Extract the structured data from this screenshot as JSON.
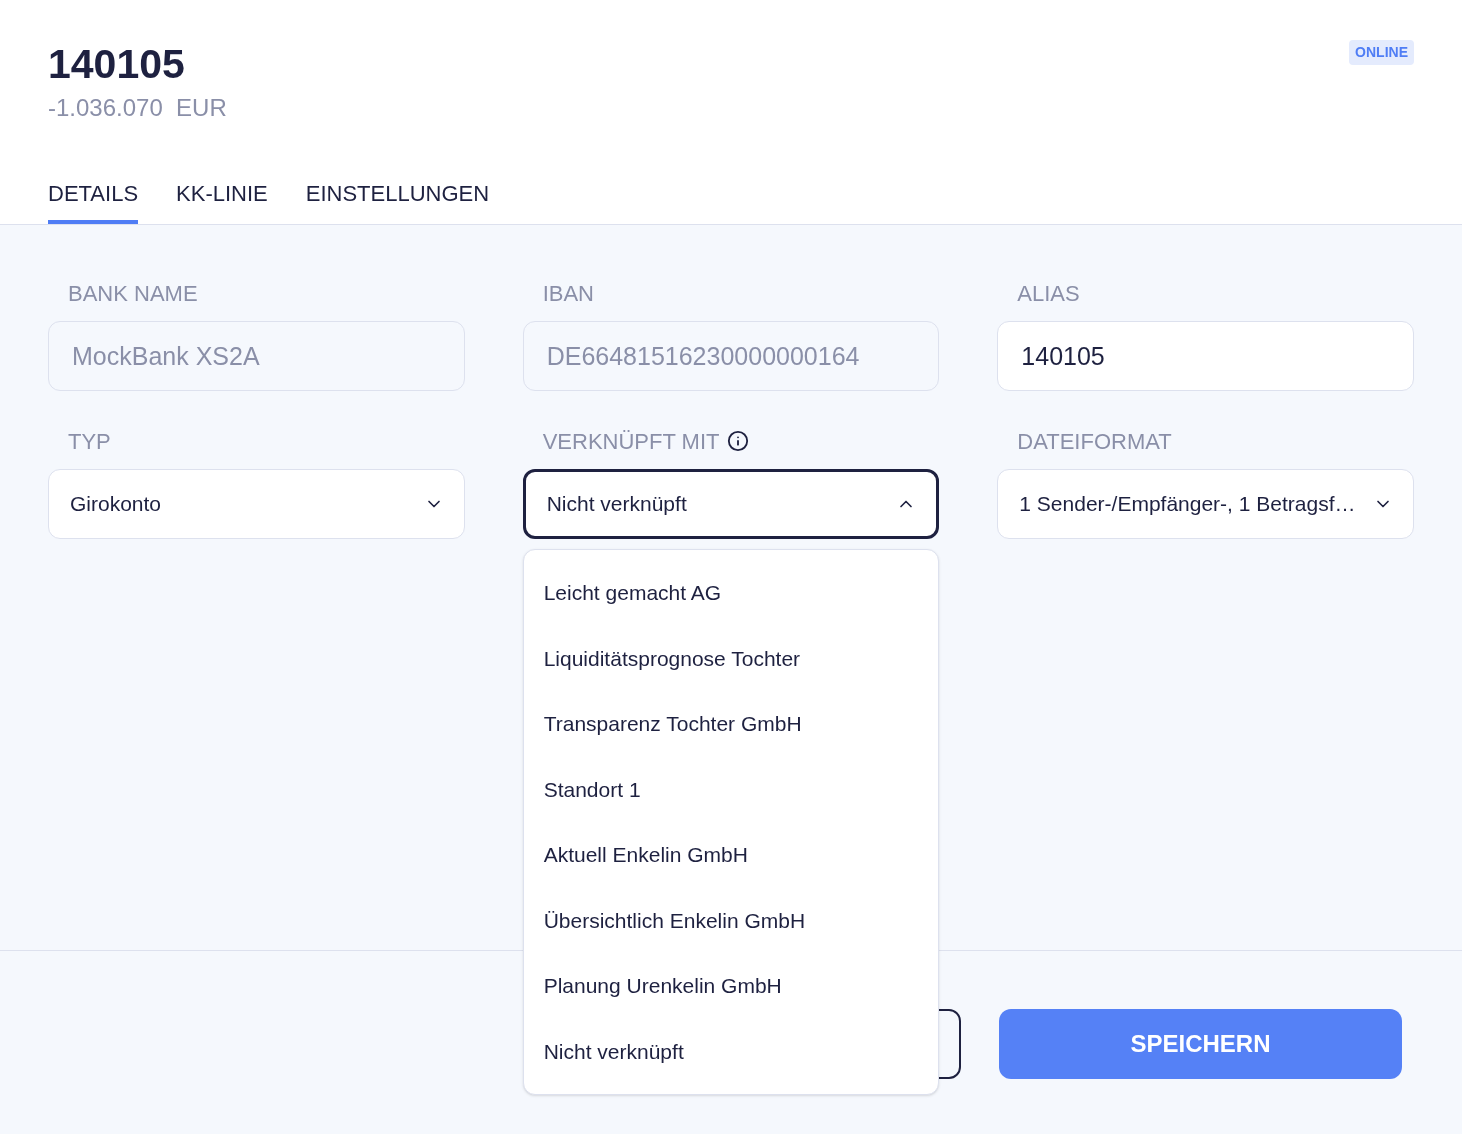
{
  "header": {
    "title": "140105",
    "balance": "-1.036.070  EUR",
    "status_badge": "ONLINE"
  },
  "tabs": [
    {
      "label": "DETAILS",
      "selected": true
    },
    {
      "label": "KK-LINIE",
      "selected": false
    },
    {
      "label": "EINSTELLUNGEN",
      "selected": false
    }
  ],
  "fields": [
    {
      "kind": "input",
      "label": "BANK NAME",
      "value": "MockBank XS2A",
      "disabled": true,
      "info": false
    },
    {
      "kind": "input",
      "label": "IBAN",
      "value": "DE66481516230000000164",
      "disabled": true,
      "info": false
    },
    {
      "kind": "input",
      "label": "ALIAS",
      "value": "140105",
      "disabled": false,
      "info": false
    },
    {
      "kind": "select",
      "label": "TYP",
      "value": "Girokonto",
      "expanded": false,
      "info": false
    },
    {
      "kind": "select",
      "label": "VERKNÜPFT MIT",
      "value": "Nicht verknüpft",
      "expanded": true,
      "info": true,
      "options": [
        "Leicht gemacht AG",
        "Liquiditätsprognose Tochter",
        "Transparenz Tochter GmbH",
        "Standort 1",
        "Aktuell Enkelin GmbH",
        "Übersichtlich Enkelin GmbH",
        "Planung Urenkelin GmbH",
        "Nicht verknüpft"
      ]
    },
    {
      "kind": "select",
      "label": "DATEIFORMAT",
      "value": "1 Sender-/Empfänger-, 1 Betragsf…",
      "expanded": false,
      "info": false
    }
  ],
  "footer": {
    "save_button": "SPEICHERN"
  }
}
